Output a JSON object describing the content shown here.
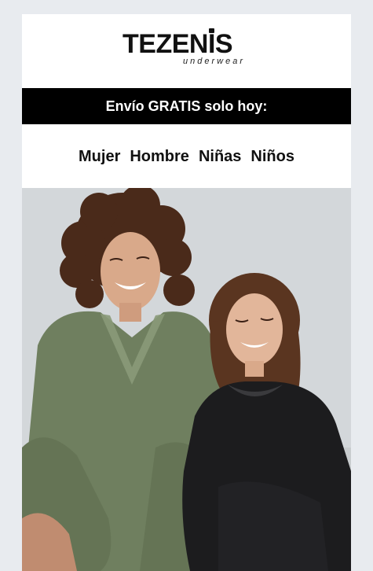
{
  "brand": {
    "name": "TEZENIS",
    "tagline": "underwear"
  },
  "promo": {
    "text": "Envío GRATIS solo hoy:"
  },
  "nav": {
    "items": [
      {
        "label": "Mujer"
      },
      {
        "label": "Hombre"
      },
      {
        "label": "Niñas"
      },
      {
        "label": "Niños"
      }
    ]
  },
  "colors": {
    "promo_background": "#000000",
    "promo_text": "#ffffff",
    "page_background": "#e8ebef",
    "green_top": "#6f7f5f",
    "black_top": "#1c1c1e"
  }
}
